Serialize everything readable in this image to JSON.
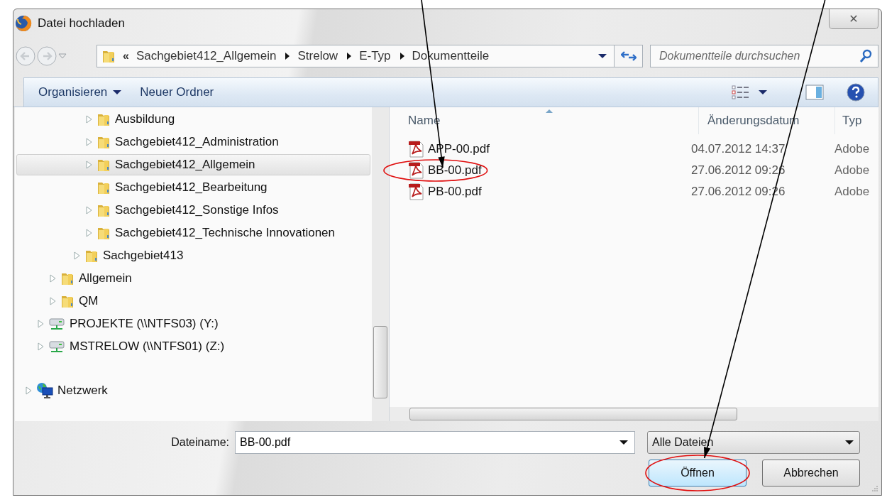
{
  "window": {
    "title": "Datei hochladen",
    "close": "✕"
  },
  "address_bar": {
    "overflow": "«",
    "path": [
      "Sachgebiet412_Allgemein",
      "Strelow",
      "E-Typ",
      "Dokumentteile"
    ]
  },
  "search": {
    "placeholder": "Dokumentteile durchsuchen"
  },
  "toolbar": {
    "organize": "Organisieren",
    "new_folder": "Neuer Ordner"
  },
  "tree": [
    {
      "children": [
        {
          "children": [
            {
              "children": [
                {
                  "children": [
                    {
                      "children": [
                        {
                          "label": "Ausbildung",
                          "kind": "folder",
                          "expandable": true,
                          "selected": false
                        },
                        {
                          "label": "Sachgebiet412_Administration",
                          "kind": "folder",
                          "expandable": true,
                          "selected": false
                        },
                        {
                          "label": "Sachgebiet412_Allgemein",
                          "kind": "folder",
                          "expandable": true,
                          "selected": true
                        },
                        {
                          "label": "Sachgebiet412_Bearbeitung",
                          "kind": "folder",
                          "expandable": false,
                          "selected": false
                        },
                        {
                          "label": "Sachgebiet412_Sonstige Infos",
                          "kind": "folder",
                          "expandable": true,
                          "selected": false
                        },
                        {
                          "label": "Sachgebiet412_Technische Innovationen",
                          "kind": "folder",
                          "expandable": true,
                          "selected": false
                        }
                      ]
                    },
                    {
                      "label": "Sachgebiet413",
                      "kind": "folder",
                      "expandable": true,
                      "selected": false
                    }
                  ]
                }
              ]
            },
            {
              "label": "Allgemein",
              "kind": "folder",
              "expandable": true,
              "selected": false
            },
            {
              "label": "QM",
              "kind": "folder",
              "expandable": true,
              "selected": false
            }
          ]
        },
        {
          "label": "PROJEKTE (\\\\NTFS03) (Y:)",
          "kind": "drive",
          "expandable": true,
          "selected": false
        },
        {
          "label": "MSTRELOW (\\\\NTFS01) (Z:)",
          "kind": "drive",
          "expandable": true,
          "selected": false
        }
      ]
    },
    {
      "label": "Netzwerk",
      "kind": "network",
      "expandable": true,
      "selected": false
    }
  ],
  "file_list": {
    "columns": [
      "Name",
      "Änderungsdatum",
      "Typ"
    ],
    "files": [
      {
        "name": "APP-00.pdf",
        "date": "04.07.2012 14:37",
        "type": "Adobe",
        "highlighted": false
      },
      {
        "name": "BB-00.pdf",
        "date": "27.06.2012 09:26",
        "type": "Adobe",
        "highlighted": true
      },
      {
        "name": "PB-00.pdf",
        "date": "27.06.2012 09:26",
        "type": "Adobe",
        "highlighted": false
      }
    ]
  },
  "filename": {
    "label": "Dateiname:",
    "value": "BB-00.pdf"
  },
  "filter": {
    "value": "Alle Dateien"
  },
  "buttons": [
    {
      "label": "Öffnen",
      "kind": "open",
      "highlighted": true
    },
    {
      "label": "Abbrechen",
      "kind": "cancel",
      "highlighted": false
    }
  ]
}
